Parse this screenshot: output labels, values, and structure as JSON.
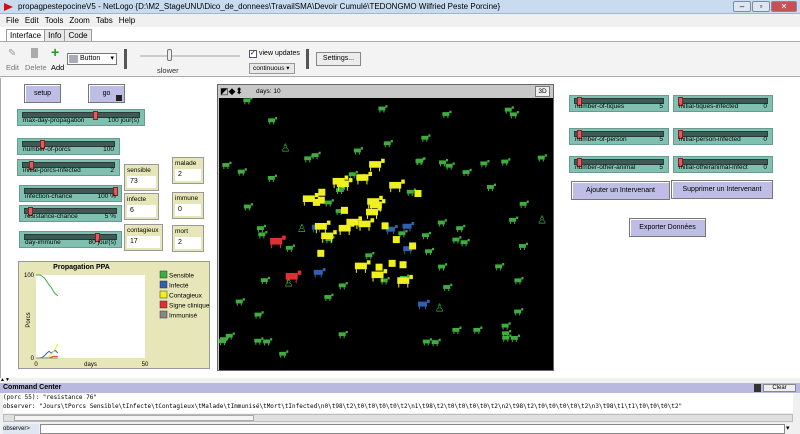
{
  "window": {
    "title": "propagpestepocineV5 - NetLogo {D:\\M2_StageUNU\\Dico_de_donnees\\TravailSMA\\Devoir Cumulé\\TEDONGMO Wilfried Peste Porcine}"
  },
  "menu": [
    "File",
    "Edit",
    "Tools",
    "Zoom",
    "Tabs",
    "Help"
  ],
  "tabs": [
    "Interface",
    "Info",
    "Code"
  ],
  "toolbar": {
    "edit": "Edit",
    "delete": "Delete",
    "add": "Add",
    "widget_type": "Button",
    "speed_label": "slower",
    "view_updates_label": "view updates",
    "view_updates_checked": true,
    "update_mode": "continuous",
    "settings": "Settings..."
  },
  "buttons": {
    "setup": "setup",
    "go": "go",
    "ajouter": "Ajouter un Intervenant",
    "supprimer": "Supprimer un Intervenant",
    "exporter": "Exporter Données"
  },
  "sliders": [
    {
      "name": "max-day-propagation",
      "value": "100 jour(s)",
      "fraction": 0.62
    },
    {
      "name": "number-of-porcs",
      "value": "100",
      "fraction": 0.2
    },
    {
      "name": "initial-porcs-infected",
      "value": "2",
      "fraction": 0.08
    },
    {
      "name": "infection-chance",
      "value": "100 %",
      "fraction": 1.0
    },
    {
      "name": "resistance-chance",
      "value": "5 %",
      "fraction": 0.05
    },
    {
      "name": "day-immune",
      "value": "80 jour(s)",
      "fraction": 0.8
    },
    {
      "name": "number-of-tiques",
      "value": "5",
      "fraction": 0.03
    },
    {
      "name": "initial-tiques-infected",
      "value": "0",
      "fraction": 0.0
    },
    {
      "name": "number-of-person",
      "value": "5",
      "fraction": 0.03
    },
    {
      "name": "initial-person-infected",
      "value": "0",
      "fraction": 0.0
    },
    {
      "name": "number-other-animal",
      "value": "5",
      "fraction": 0.03
    },
    {
      "name": "initial-otheranimal-infect",
      "value": "0",
      "fraction": 0.0
    }
  ],
  "monitors": [
    {
      "label": "sensible",
      "value": "73"
    },
    {
      "label": "malade",
      "value": "2"
    },
    {
      "label": "infecte",
      "value": "6"
    },
    {
      "label": "immune",
      "value": "0"
    },
    {
      "label": "contagieux",
      "value": "17"
    },
    {
      "label": "mort",
      "value": "2"
    }
  ],
  "view": {
    "ticks_label": "days: 10",
    "speed": "3D"
  },
  "colors": {
    "sensible": "#3fae3f",
    "infecte": "#3060b0",
    "contagieux": "#f0f020",
    "signe": "#e03030",
    "immunise": "#888888"
  },
  "chart_data": {
    "type": "line",
    "title": "Propagation PPA",
    "xlabel": "days",
    "ylabel": "Porcs",
    "xlim": [
      0,
      50
    ],
    "ylim": [
      0,
      100
    ],
    "xticks": [
      "0",
      "50"
    ],
    "yticks": [
      "0",
      "100"
    ],
    "legend": "right",
    "grid": false,
    "x": [
      0,
      1,
      2,
      3,
      4,
      5,
      6,
      7,
      8,
      9,
      10
    ],
    "series": [
      {
        "name": "Sensible",
        "color": "#3fae3f",
        "values": [
          100,
          100,
          100,
          98,
          96,
          92,
          88,
          85,
          80,
          77,
          75
        ]
      },
      {
        "name": "Infecté",
        "color": "#3060b0",
        "values": [
          0,
          0,
          0,
          1,
          3,
          6,
          8,
          6,
          8,
          9,
          6
        ]
      },
      {
        "name": "Contagieux",
        "color": "#f0f020",
        "values": [
          0,
          0,
          0,
          0,
          0,
          1,
          2,
          4,
          8,
          12,
          17
        ]
      },
      {
        "name": "Signe clinique",
        "color": "#e03030",
        "values": [
          0,
          0,
          0,
          0,
          0,
          0,
          0,
          1,
          2,
          2,
          2
        ]
      },
      {
        "name": "Immunisé",
        "color": "#888888",
        "values": [
          0,
          0,
          0,
          0,
          0,
          0,
          0,
          0,
          0,
          0,
          0
        ]
      }
    ]
  },
  "command_center": {
    "title": "Command Center",
    "clear": "Clear",
    "lines": [
      "(porc 55): \"resistance 76\"",
      "observer: \"Jours\\tPorcs Sensible\\tInfecte\\tContagieux\\tMalade\\tImmunisé\\tMort\\tInfected\\n0\\t98\\t2\\t0\\t0\\t0\\t0\\t2\\n1\\t98\\t2\\t0\\t0\\t0\\t0\\t2\\n2\\t98\\t2\\t0\\t0\\t0\\t0\\t2\\n3\\t98\\t1\\t1\\t0\\t0\\t0\\t2\""
    ],
    "prompt": "observer>",
    "input": ""
  }
}
